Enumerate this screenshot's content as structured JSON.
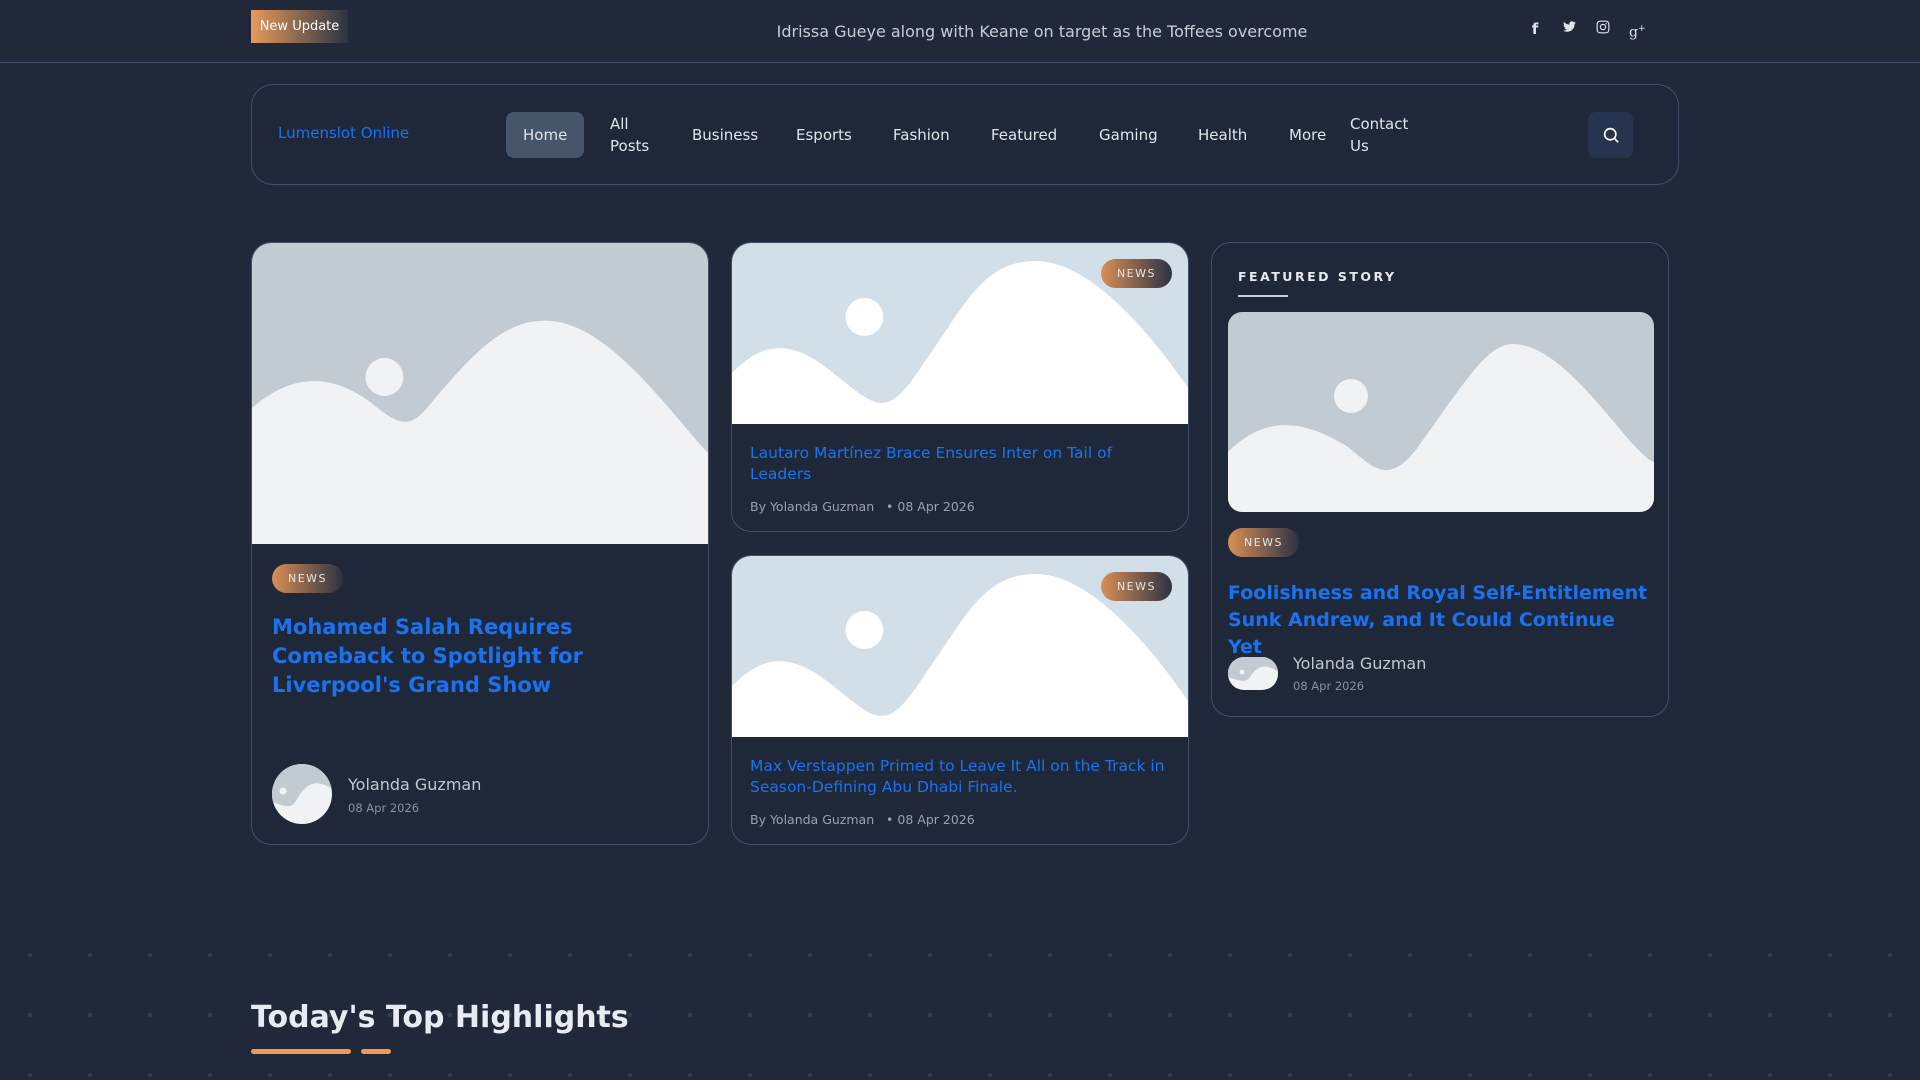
{
  "topbar": {
    "badge": "New Update",
    "ticker": "Idrissa Gueye along with Keane on target as the Toffees overcome",
    "social": [
      "facebook-icon",
      "twitter-icon",
      "instagram-icon",
      "google-plus-icon"
    ]
  },
  "nav": {
    "logo": "Lumenslot Online",
    "items": [
      "Home",
      "All Posts",
      "Business",
      "Esports",
      "Fashion",
      "Featured",
      "Gaming",
      "Health",
      "More",
      "Contact Us"
    ]
  },
  "cards": [
    {
      "tag": "NEWS",
      "title": "Mohamed Salah Requires Comeback to Spotlight for Liverpool's Grand Show",
      "author": "Yolanda Guzman",
      "date": "08 Apr 2026"
    },
    {
      "tag": "NEWS",
      "title": "Lautaro Martínez Brace Ensures Inter on Tail of Leaders",
      "author": "By Yolanda Guzman",
      "date": "• 08 Apr 2026"
    },
    {
      "tag": "NEWS",
      "title": "Max Verstappen Primed to Leave It All on the Track in Season-Defining Abu Dhabi Finale.",
      "author": "By Yolanda Guzman",
      "date": "• 08 Apr 2026"
    }
  ],
  "featured": {
    "heading": "FEATURED STORY",
    "tag": "NEWS",
    "title": "Foolishness and Royal Self-Entitlement Sunk Andrew, and It Could Continue Yet",
    "author": "Yolanda Guzman",
    "date": "08 Apr 2026"
  },
  "highlights": {
    "title": "Today's Top Highlights"
  },
  "colors": {
    "background": "#202839",
    "accent": "#1b72f0",
    "orange": "#f09a56"
  }
}
